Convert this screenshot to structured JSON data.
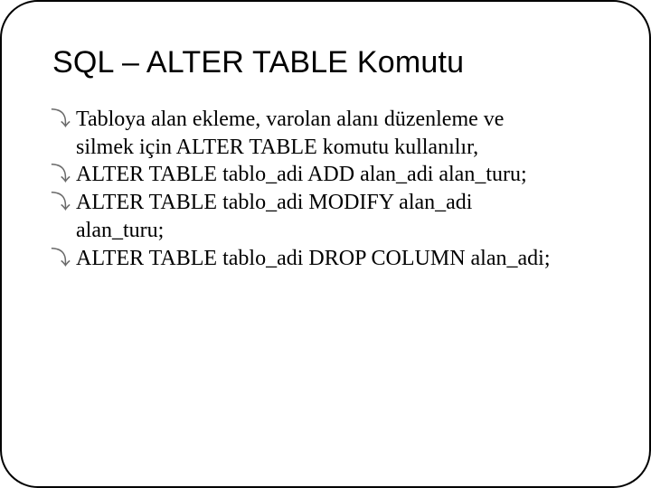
{
  "title": "SQL – ALTER TABLE Komutu",
  "bullets": [
    {
      "line1": "Tabloya alan ekleme, varolan alanı düzenleme ve",
      "line2": "silmek için ALTER TABLE komutu kullanılır,"
    },
    {
      "line1": "ALTER TABLE tablo_adi ADD alan_adi alan_turu;"
    },
    {
      "line1": "ALTER TABLE tablo_adi MODIFY alan_adi",
      "line2": "alan_turu;"
    },
    {
      "line1": "ALTER TABLE tablo_adi DROP COLUMN alan_adi;"
    }
  ],
  "marker": "⤵"
}
